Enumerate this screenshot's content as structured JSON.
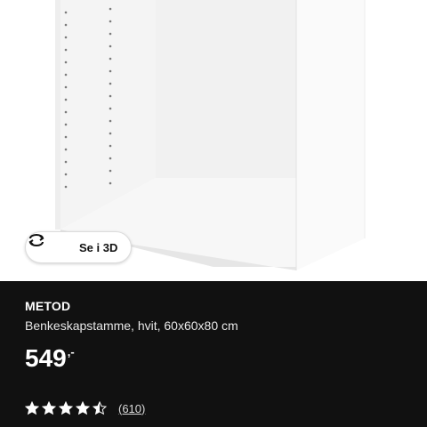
{
  "product_image": {
    "view3d_label": "Se i 3D",
    "view3d_icon": "rotate-3d-icon"
  },
  "product": {
    "name": "METOD",
    "description": "Benkeskapstamme, hvit, 60x60x80 cm",
    "price": "549",
    "price_suffix": ",-",
    "rating": 4.5,
    "rating_max": 5,
    "review_count": "(610)"
  },
  "colors": {
    "panel_background": "#111111",
    "text": "#ffffff",
    "image_background": "#ffffff"
  }
}
